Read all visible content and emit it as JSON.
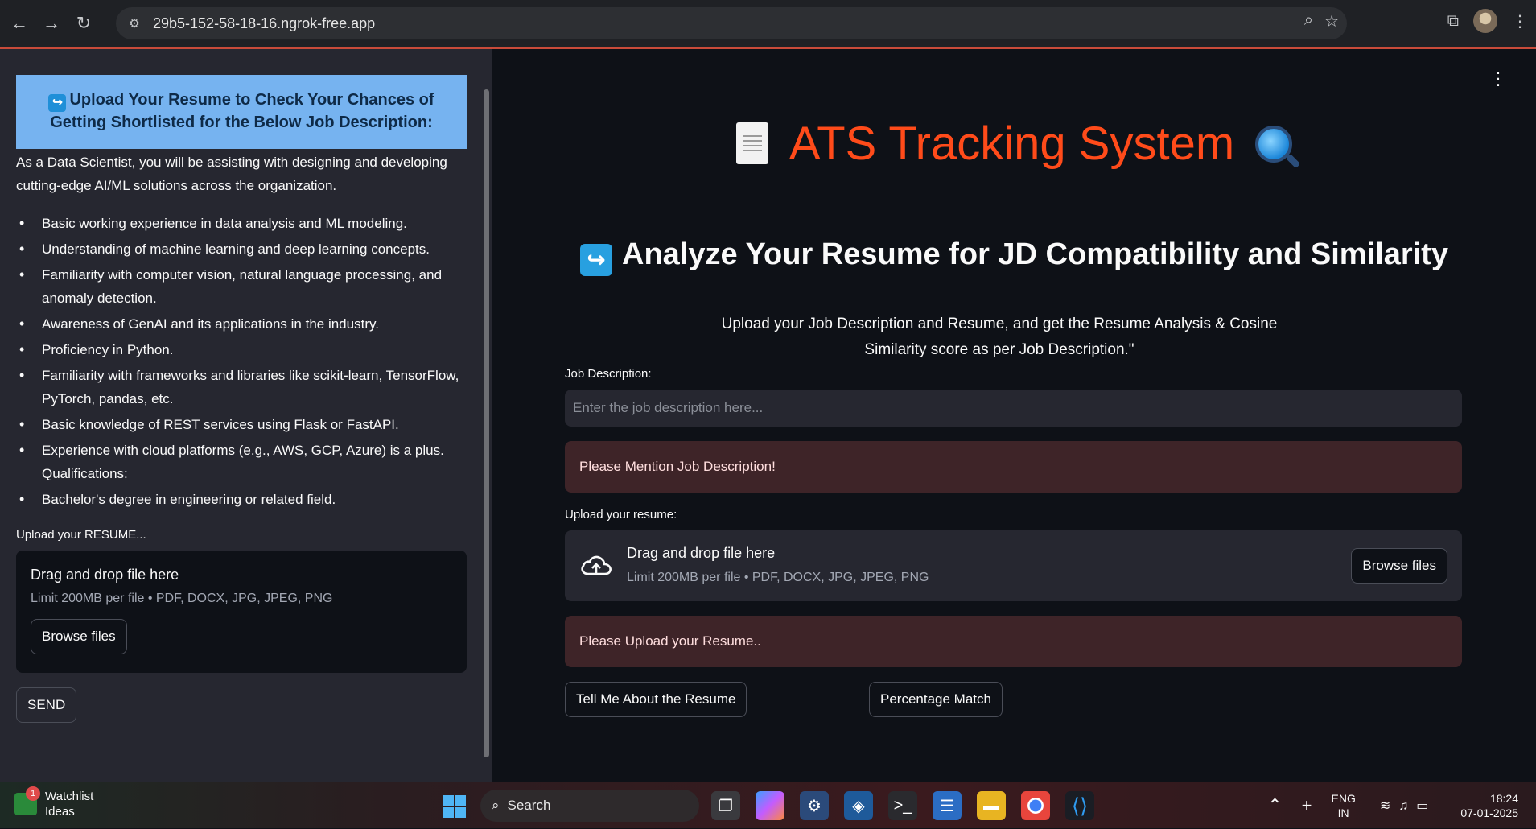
{
  "browser": {
    "url": "29b5-152-58-18-16.ngrok-free.app"
  },
  "sidebar": {
    "banner_icon": "↪",
    "banner_title": "Upload Your Resume to Check Your Chances of Getting Shortlisted for the Below Job Description:",
    "intro": "As a Data Scientist, you will be assisting with designing and developing cutting-edge AI/ML solutions across the organization.",
    "requirements": [
      "Basic working experience in data analysis and ML modeling.",
      "Understanding of machine learning and deep learning concepts.",
      "Familiarity with computer vision, natural language processing, and anomaly detection.",
      "Awareness of GenAI and its applications in the industry.",
      "Proficiency in Python.",
      "Familiarity with frameworks and libraries like scikit-learn, TensorFlow, PyTorch, pandas, etc.",
      "Basic knowledge of REST services using Flask or FastAPI.",
      "Experience with cloud platforms (e.g., AWS, GCP, Azure) is a plus. Qualifications:",
      "Bachelor's degree in engineering or related field."
    ],
    "upload_label": "Upload your RESUME...",
    "dropzone_title": "Drag and drop file here",
    "dropzone_limit": "Limit 200MB per file • PDF, DOCX, JPG, JPEG, PNG",
    "browse_label": "Browse files",
    "send_label": "SEND"
  },
  "main": {
    "title": "ATS Tracking System",
    "subheader_icon": "↪",
    "subheader": "Analyze Your Resume for JD Compatibility and Similarity",
    "description": "Upload your Job Description and Resume, and get the Resume Analysis & Cosine Similarity score as per Job Description.\"",
    "jd_label": "Job Description:",
    "jd_placeholder": "Enter the job description here...",
    "jd_value": "",
    "jd_alert": "Please Mention Job Description!",
    "resume_label": "Upload your resume:",
    "dropzone_title": "Drag and drop file here",
    "dropzone_limit": "Limit 200MB per file • PDF, DOCX, JPG, JPEG, PNG",
    "browse_label": "Browse files",
    "resume_alert": "Please Upload your Resume..",
    "btn_tell": "Tell Me About the Resume",
    "btn_match": "Percentage Match"
  },
  "taskbar": {
    "widget_badge": "1",
    "widget_title": "Watchlist",
    "widget_sub": "Ideas",
    "search_label": "Search",
    "lang_top": "ENG",
    "lang_bottom": "IN",
    "time": "18:24",
    "date": "07-01-2025"
  },
  "colors": {
    "title_accent": "#ff4b1a",
    "banner_bg": "#76b3f0",
    "alert_bg": "#3e2428",
    "sidebar_bg": "#262730",
    "main_bg": "#0e1117"
  }
}
